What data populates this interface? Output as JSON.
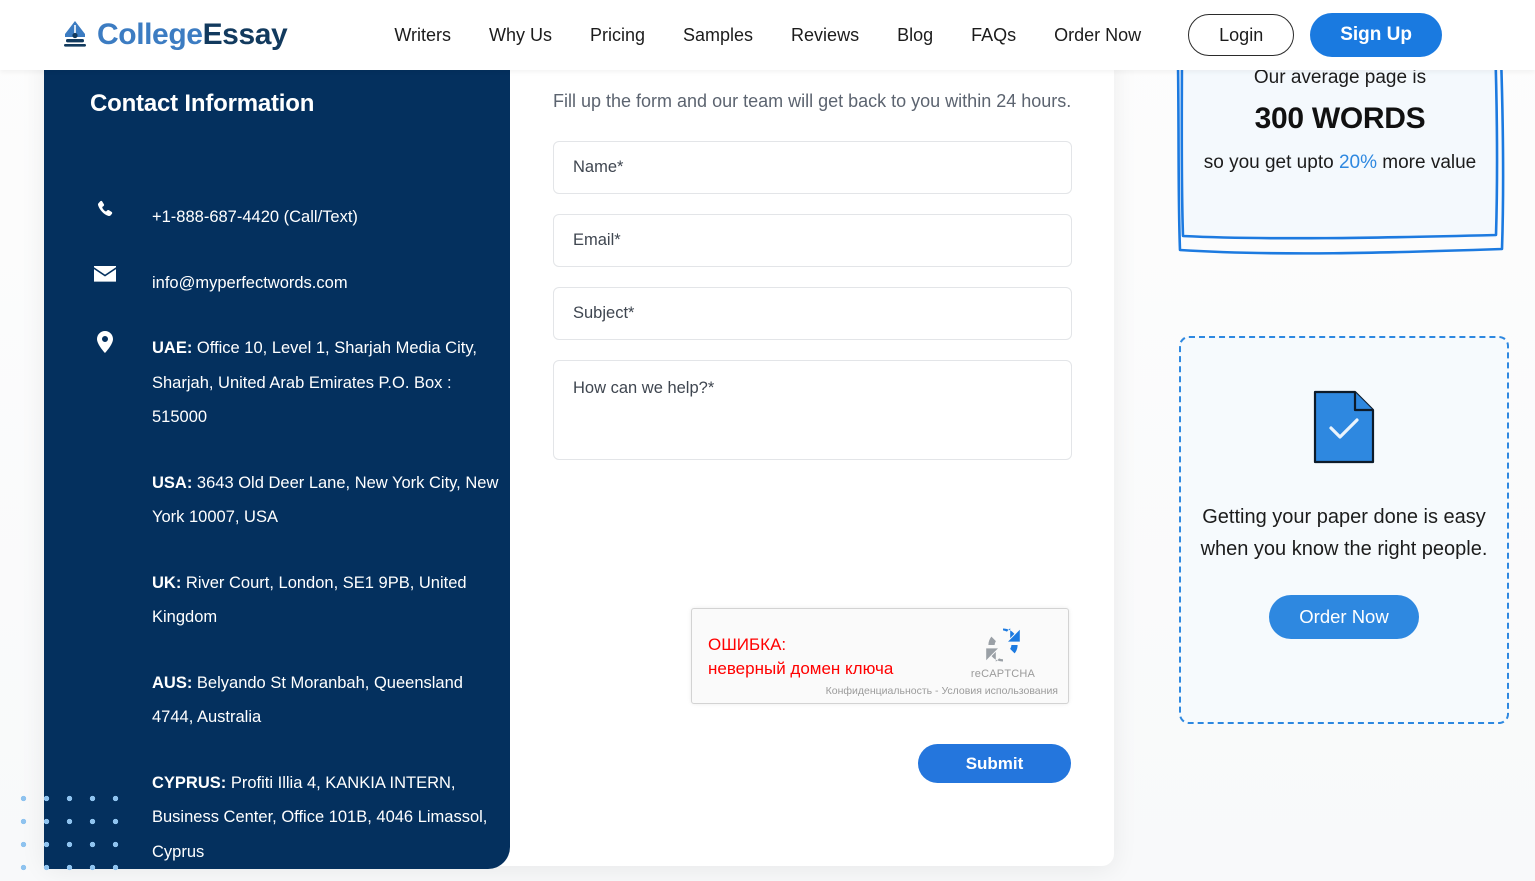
{
  "header": {
    "logo": {
      "icon": "pen-nib-icon",
      "part1": "College",
      "part2": "Essay"
    },
    "nav": [
      {
        "label": "Writers"
      },
      {
        "label": "Why Us"
      },
      {
        "label": "Pricing"
      },
      {
        "label": "Samples"
      },
      {
        "label": "Reviews"
      },
      {
        "label": "Blog"
      },
      {
        "label": "FAQs"
      },
      {
        "label": "Order Now"
      }
    ],
    "login_label": "Login",
    "signup_label": "Sign Up"
  },
  "contact": {
    "title": "Contact Information",
    "phone": {
      "icon": "phone-icon",
      "text": "+1-888-687-4420 (Call/Text)"
    },
    "email": {
      "icon": "envelope-icon",
      "text": "info@myperfectwords.com"
    },
    "location_icon": "map-pin-icon",
    "addresses": [
      {
        "country": "UAE:",
        "lines": " Office 10, Level 1, Sharjah Media City, Sharjah, United Arab Emirates P.O. Box : 515000"
      },
      {
        "country": "USA:",
        "lines": " 3643 Old Deer Lane, New York City, New York 10007, USA"
      },
      {
        "country": "UK:",
        "lines": " River Court, London, SE1 9PB, United Kingdom"
      },
      {
        "country": "AUS:",
        "lines": " Belyando St Moranbah, Queensland 4744, Australia"
      },
      {
        "country": "CYPRUS:",
        "lines": " Profiti Illia 4, KANKIA INTERN, Business Center, Office 101B, 4046 Limassol, Cyprus"
      }
    ]
  },
  "form": {
    "intro": "Fill up the form and our team will get back to you within 24 hours.",
    "name_placeholder": "Name*",
    "name_value": "",
    "email_placeholder": "Email*",
    "email_value": "",
    "subject_placeholder": "Subject*",
    "subject_value": "",
    "message_placeholder": "How can we help?*",
    "message_value": "",
    "submit_label": "Submit"
  },
  "recaptcha": {
    "error_line1": "ОШИБКА:",
    "error_line2": "неверный домен ключа",
    "brand": "reCAPTCHA",
    "terms": "Конфиденциальность - Условия использования",
    "icon": "recaptcha-icon"
  },
  "rail": {
    "sketch_card": {
      "top_text": "Our average page is",
      "headline": "300 WORDS",
      "sub_before": "so you get upto ",
      "sub_accent": "20%",
      "sub_after": " more value"
    },
    "dashed_card": {
      "icon": "document-check-icon",
      "text": "Getting your paper done is easy when you know the right people.",
      "cta_label": "Order Now"
    }
  },
  "colors": {
    "navy": "#04305e",
    "brand_blue": "#2e88e0",
    "signup_blue": "#1a7ae0",
    "submit_blue": "#2476dd",
    "error_red": "#ff0000",
    "dot_blue": "#8fc3ef"
  }
}
